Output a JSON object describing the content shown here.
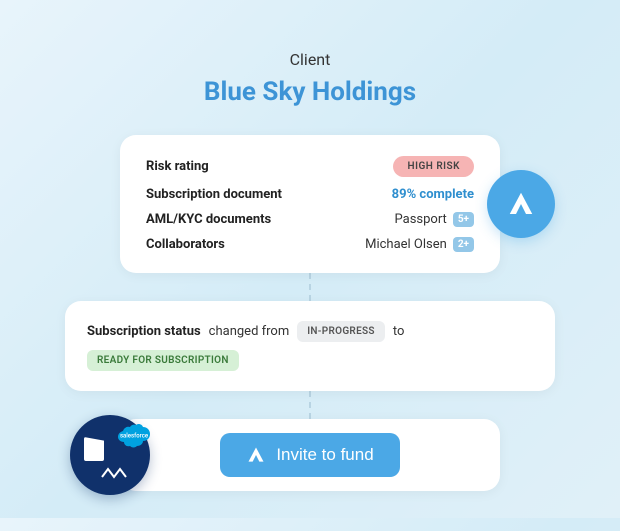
{
  "header": {
    "label": "Client",
    "name": "Blue Sky Holdings"
  },
  "info": {
    "risk_label": "Risk rating",
    "risk_value": "HIGH RISK",
    "subdoc_label": "Subscription document",
    "subdoc_value": "89% complete",
    "aml_label": "AML/KYC documents",
    "aml_value": "Passport",
    "aml_count": "5+",
    "collab_label": "Collaborators",
    "collab_value": "Michael Olsen",
    "collab_count": "2+"
  },
  "status": {
    "bold": "Subscription status",
    "text1": "changed from",
    "from": "IN-PROGRESS",
    "text2": "to",
    "to": "READY FOR SUBSCRIPTION"
  },
  "action": {
    "invite_label": "Invite to fund"
  },
  "integrations": {
    "salesforce": "salesforce"
  }
}
